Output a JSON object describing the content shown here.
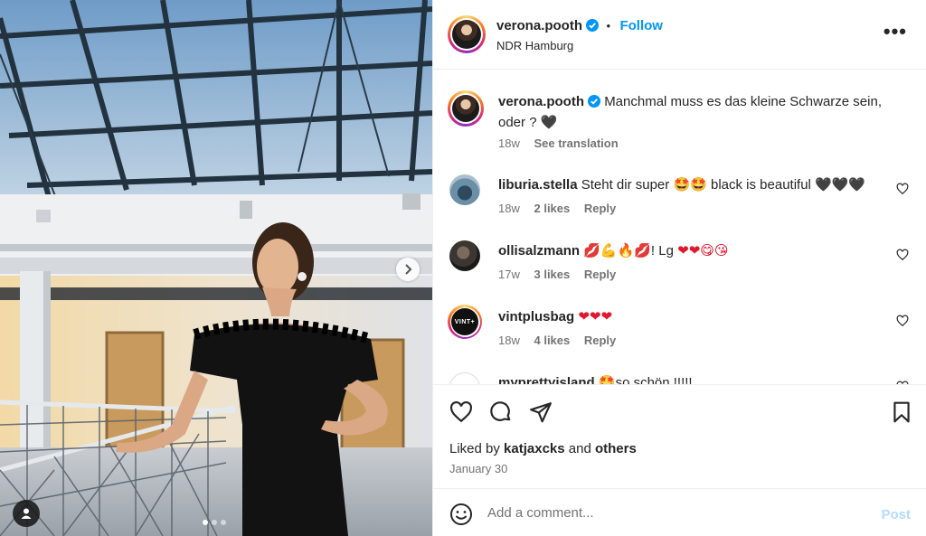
{
  "post": {
    "author": "verona.pooth",
    "follow_label": "Follow",
    "location": "NDR Hamburg",
    "more_label": "•••",
    "caption": {
      "author": "verona.pooth",
      "text": "Manchmal muss es das kleine Schwarze sein, oder ?",
      "emoji": "🖤",
      "time": "18w",
      "translate_label": "See translation"
    },
    "comments": [
      {
        "user": "liburia.stella",
        "text": "Steht dir super",
        "emoji_a": "🤩🤩",
        "text2": "black is beautiful",
        "emoji_b": "🖤🖤🖤",
        "time": "18w",
        "likes": "2 likes",
        "reply": "Reply"
      },
      {
        "user": "ollisalzmann",
        "emoji_a": "💋💪🔥💋",
        "text": "! Lg",
        "emoji_b": "❤❤😋😘",
        "time": "17w",
        "likes": "3 likes",
        "reply": "Reply"
      },
      {
        "user": "vintplusbag",
        "emoji_a": "❤❤❤",
        "time": "18w",
        "likes": "4 likes",
        "reply": "Reply",
        "avatar_text": "VINT+"
      },
      {
        "user": "myprettyisland",
        "emoji_a": "🤩",
        "text": "so schön !!!!!"
      }
    ],
    "liked_by_prefix": "Liked by",
    "liked_by_user": "katjaxcks",
    "liked_by_and": "and",
    "liked_by_others": "others",
    "date": "January 30",
    "comment_placeholder": "Add a comment...",
    "post_label": "Post"
  },
  "carousel": {
    "slides": 3,
    "active": 1
  },
  "colors": {
    "accent": "#0095f6",
    "text": "#262626",
    "muted": "#737373",
    "post_disabled": "#b3dbff",
    "heart_red": "#e0172d"
  }
}
